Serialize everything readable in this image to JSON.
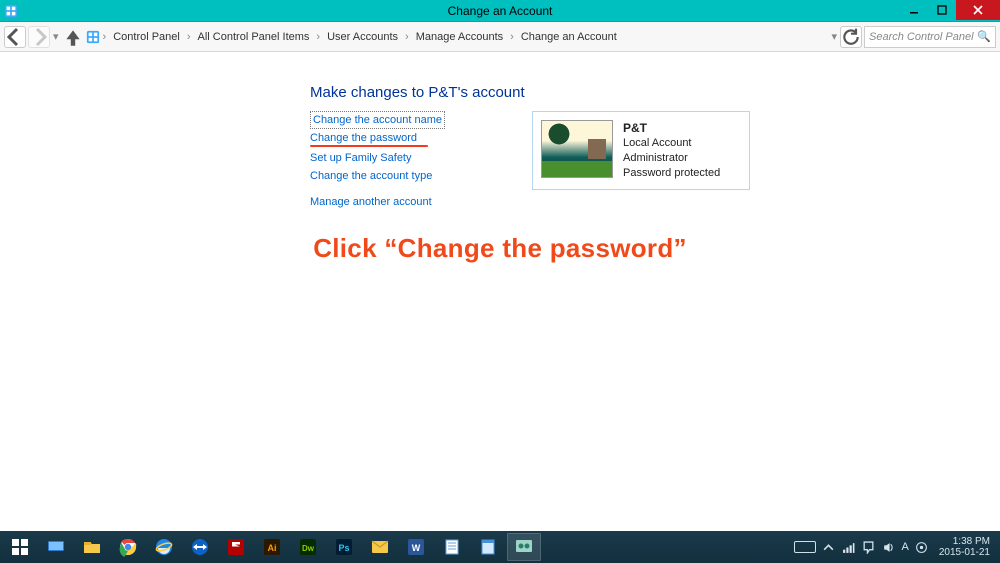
{
  "titlebar": {
    "title": "Change an Account"
  },
  "breadcrumb": {
    "items": [
      "Control Panel",
      "All Control Panel Items",
      "User Accounts",
      "Manage Accounts",
      "Change an Account"
    ]
  },
  "search": {
    "placeholder": "Search Control Panel"
  },
  "heading": "Make changes to P&T's account",
  "links": {
    "change_name": "Change the account name",
    "change_password": "Change the password",
    "family_safety": "Set up Family Safety",
    "change_type": "Change the account type",
    "manage_other": "Manage another account"
  },
  "account": {
    "name": "P&T",
    "type": "Local Account",
    "role": "Administrator",
    "protection": "Password protected"
  },
  "annotation": "Click “Change the password”",
  "tray": {
    "ime": "A",
    "time": "1:38 PM",
    "date": "2015-01-21"
  }
}
